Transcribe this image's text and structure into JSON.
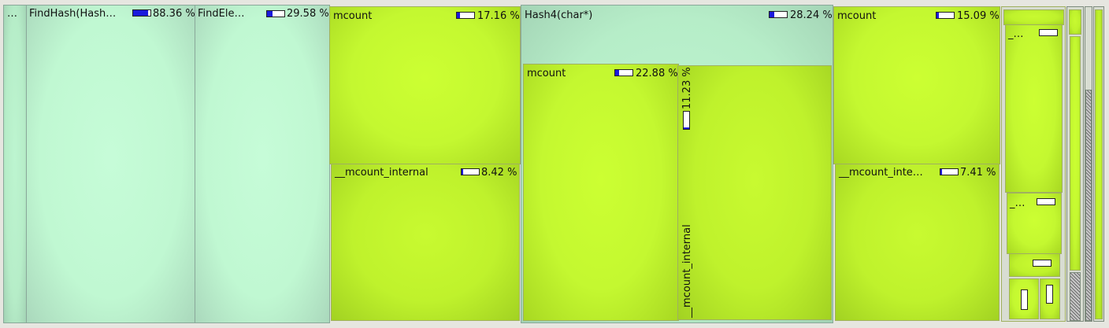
{
  "cells": {
    "ellipsis_root": {
      "label": "…"
    },
    "find_hash": {
      "label": "FindHash(Hash…",
      "pct": "88.36 %",
      "fill": 0.88
    },
    "find_ele": {
      "label": "FindEle…",
      "pct": "29.58 %",
      "fill": 0.3
    },
    "mcount_a": {
      "label": "mcount",
      "pct": "17.16 %",
      "fill": 0.17
    },
    "mcount_internal_a": {
      "label": "__mcount_internal",
      "pct": "8.42 %",
      "fill": 0.08
    },
    "hash4": {
      "label": "Hash4(char*)",
      "pct": "28.24 %",
      "fill": 0.28
    },
    "mcount_b": {
      "label": "mcount",
      "pct": "22.88 %",
      "fill": 0.23
    },
    "mcount_internal_b": {
      "label": "__mcount_internal",
      "pct": "11.23 %",
      "fill": 0.11
    },
    "mcount_c": {
      "label": "mcount",
      "pct": "15.09 %",
      "fill": 0.15
    },
    "mcount_internal_c": {
      "label": "__mcount_inte…",
      "pct": "7.41 %",
      "fill": 0.07
    },
    "small_1": {
      "label": "_…"
    },
    "small_2": {
      "label": "_…"
    },
    "small_3": {
      "label": "…"
    }
  },
  "colors": {
    "mint": "#c0f8d2",
    "lime": "#c8fc30",
    "bar_fill": "#1a1adc"
  }
}
